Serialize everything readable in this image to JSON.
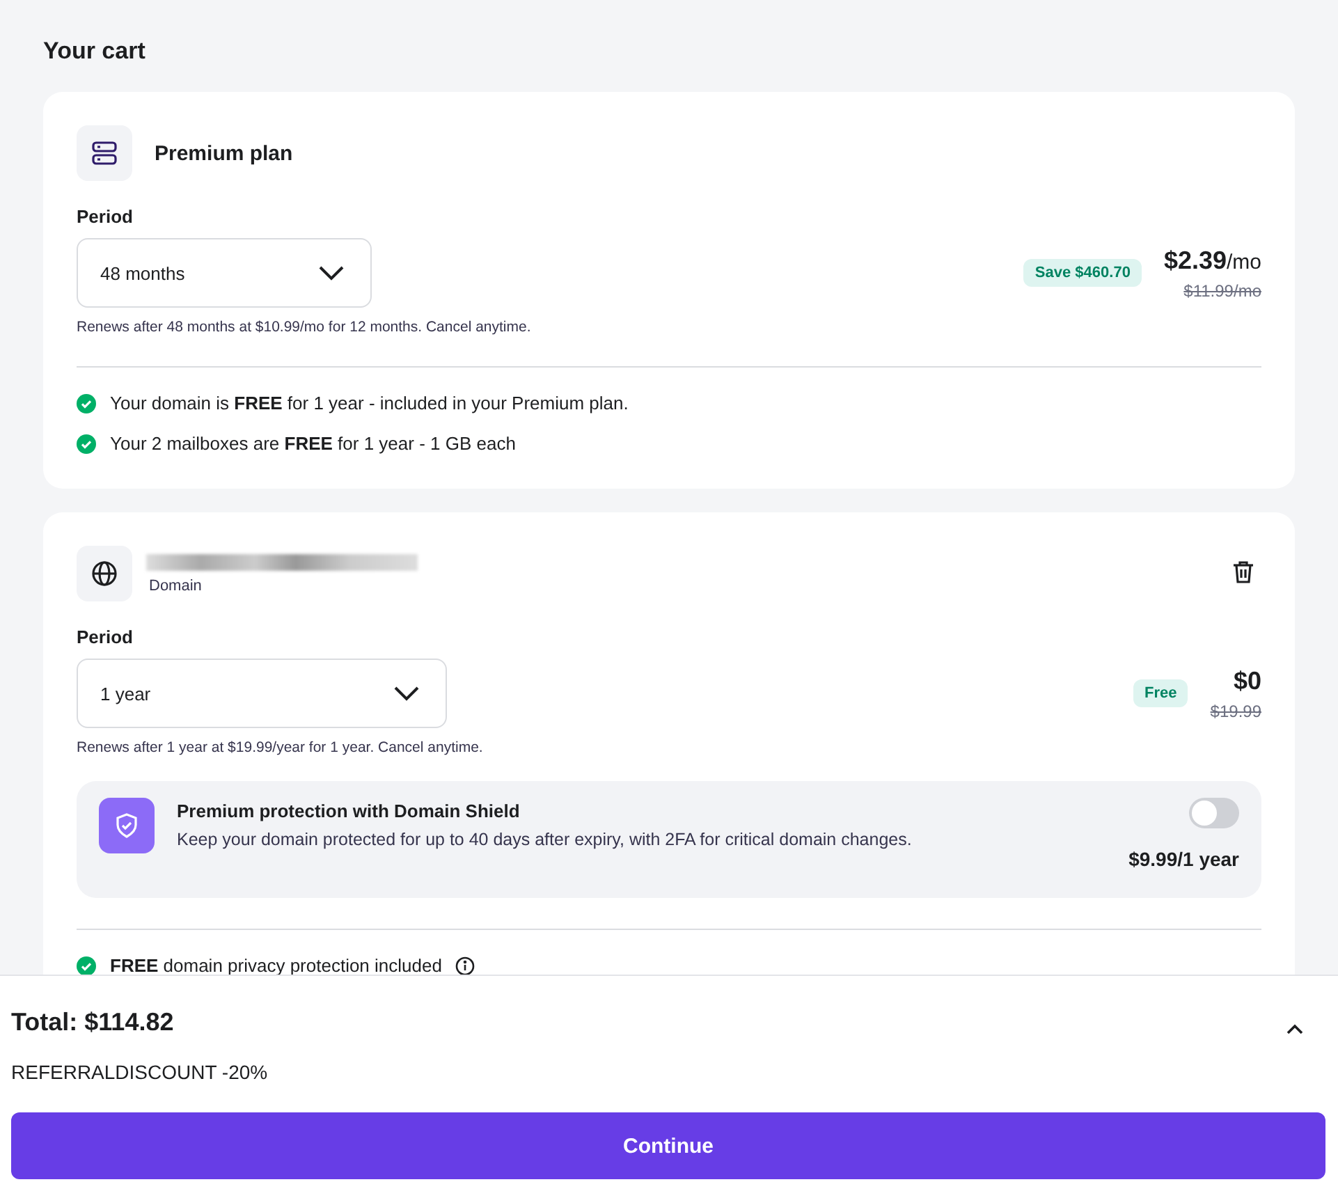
{
  "page_title": "Your cart",
  "items": [
    {
      "kind": "plan",
      "title": "Premium plan",
      "period_label": "Period",
      "period": "48 months",
      "renewal_note": "Renews after 48 months at $10.99/mo for 12 months. Cancel anytime.",
      "badge": "Save $460.70",
      "price": "$2.39",
      "price_unit": "/mo",
      "old_price": "$11.99/mo",
      "deletable": false,
      "perks": [
        {
          "text": "Your domain is **FREE** for 1 year - included in your Premium plan.",
          "info": false
        },
        {
          "text": "Your 2 mailboxes are **FREE** for 1 year - 1 GB each",
          "info": false
        }
      ]
    },
    {
      "kind": "domain",
      "subtitle": "Domain",
      "name_redacted": true,
      "period_label": "Period",
      "period": "1 year",
      "renewal_note": "Renews after 1 year at $19.99/year for 1 year. Cancel anytime.",
      "badge": "Free",
      "price": "$0",
      "old_price": "$19.99",
      "deletable": true,
      "addon": {
        "title": "Premium protection with Domain Shield",
        "description": "Keep your domain protected for up to 40 days after expiry, with 2FA for critical domain changes.",
        "price": "$9.99/1 year",
        "on": false
      },
      "perks": [
        {
          "text": "**FREE** domain privacy protection included",
          "info": true
        }
      ]
    }
  ],
  "summary": {
    "total": "Total: $114.82",
    "expanded": false,
    "coupon": "REFERRALDISCOUNT -20%",
    "button": "Continue"
  }
}
